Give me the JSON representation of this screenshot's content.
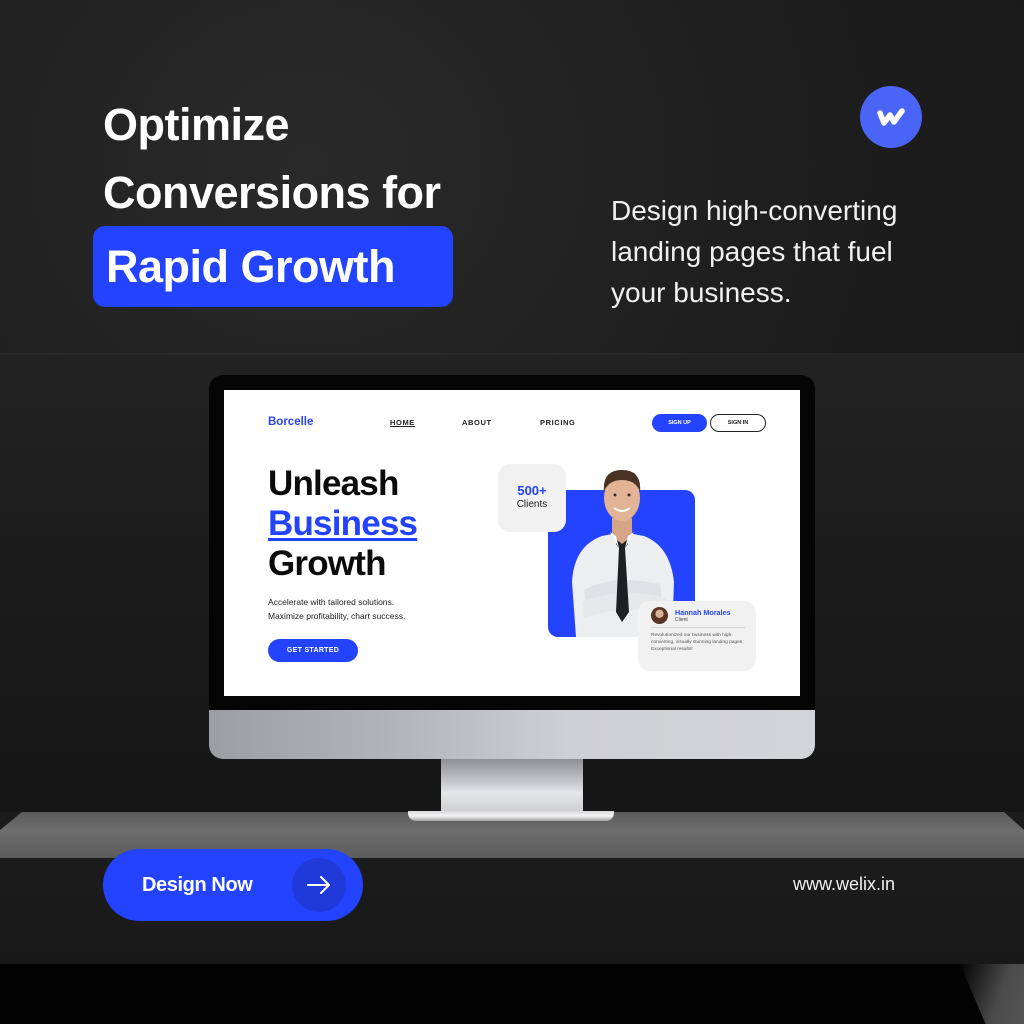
{
  "headline": {
    "line1": "Optimize",
    "line2": "Conversions for",
    "highlight": "Rapid Growth"
  },
  "logo": {
    "icon": "w-logo-icon",
    "color": "#4a64f5"
  },
  "subtext": "Design high-converting landing pages that fuel your business.",
  "mockup": {
    "brand": "Borcelle",
    "nav": [
      "HOME",
      "ABOUT",
      "PRICING"
    ],
    "active_nav": "HOME",
    "signup_label": "SIGN UP",
    "signin_label": "SIGN IN",
    "hero": {
      "title_line1": "Unleash",
      "title_line2": "Business",
      "title_line3": "Growth",
      "desc_line1": "Accelerate with tailored solutions.",
      "desc_line2": "Maximize profitability, chart success.",
      "cta_label": "GET STARTED"
    },
    "stat": {
      "value": "500+",
      "label": "Clients"
    },
    "testimonial": {
      "name": "Hannah Morales",
      "role": "Client",
      "text": "Revolutionized our business with high-converting, visually stunning landing pages. Exceptional results!"
    }
  },
  "cta": {
    "label": "Design Now",
    "icon": "arrow-right-icon"
  },
  "website": "www.welix.in",
  "colors": {
    "accent": "#2343ff",
    "background": "#1c1c1c",
    "text": "#ffffff"
  }
}
